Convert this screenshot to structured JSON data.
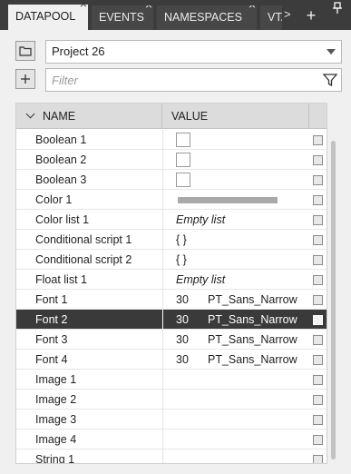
{
  "tabs": [
    {
      "label": "DATAPOOL",
      "active": true
    },
    {
      "label": "EVENTS",
      "active": false
    },
    {
      "label": "NAMESPACES",
      "active": false
    },
    {
      "label": "VTA",
      "active": false
    }
  ],
  "tab_scroll_glyph": ">",
  "add_tab_glyph": "+",
  "project": {
    "selected": "Project 26"
  },
  "filter": {
    "placeholder": "Filter",
    "value": ""
  },
  "table": {
    "headers": {
      "name": "NAME",
      "value": "VALUE"
    },
    "rows": [
      {
        "name": "Boolean 1",
        "kind": "checkbox"
      },
      {
        "name": "Boolean 2",
        "kind": "checkbox"
      },
      {
        "name": "Boolean 3",
        "kind": "checkbox"
      },
      {
        "name": "Color 1",
        "kind": "color",
        "color": "#a9a9a9"
      },
      {
        "name": "Color list 1",
        "kind": "text",
        "value": "Empty list",
        "italic": true
      },
      {
        "name": "Conditional script 1",
        "kind": "text",
        "value": "{ }"
      },
      {
        "name": "Conditional script 2",
        "kind": "text",
        "value": "{ }"
      },
      {
        "name": "Float list 1",
        "kind": "text",
        "value": "Empty list",
        "italic": true
      },
      {
        "name": "Font 1",
        "kind": "font",
        "size": "30",
        "font": "PT_Sans_Narrow"
      },
      {
        "name": "Font 2",
        "kind": "font",
        "size": "30",
        "font": "PT_Sans_Narrow",
        "selected": true
      },
      {
        "name": "Font 3",
        "kind": "font",
        "size": "30",
        "font": "PT_Sans_Narrow"
      },
      {
        "name": "Font 4",
        "kind": "font",
        "size": "30",
        "font": "PT_Sans_Narrow"
      },
      {
        "name": "Image 1",
        "kind": "empty"
      },
      {
        "name": "Image 2",
        "kind": "empty"
      },
      {
        "name": "Image 3",
        "kind": "empty"
      },
      {
        "name": "Image 4",
        "kind": "empty"
      },
      {
        "name": "String 1",
        "kind": "empty"
      }
    ]
  },
  "colors": {
    "selected_row": "#3a3a3a",
    "tab_bar": "#3c3c3c",
    "panel": "#f0f0f0"
  }
}
